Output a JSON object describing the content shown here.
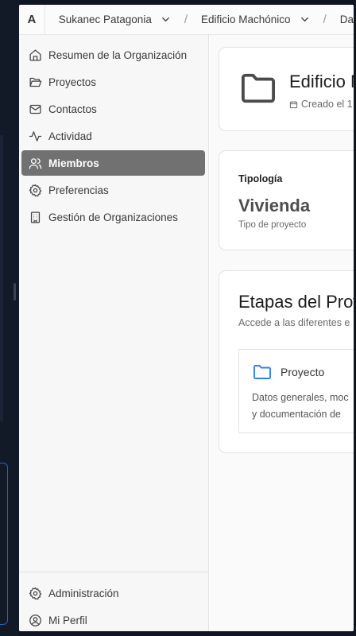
{
  "app": {
    "logo_letter": "A"
  },
  "breadcrumb": [
    {
      "label": "Sukanec Patagonia"
    },
    {
      "label": "Edificio Machónico"
    },
    {
      "label": "Da"
    }
  ],
  "breadcrumb_separator": "/",
  "sidebar": {
    "items": [
      {
        "label": "Resumen de la Organización",
        "icon": "home-icon",
        "active": false
      },
      {
        "label": "Proyectos",
        "icon": "folder-open-icon",
        "active": false
      },
      {
        "label": "Contactos",
        "icon": "mail-icon",
        "active": false
      },
      {
        "label": "Actividad",
        "icon": "activity-icon",
        "active": false
      },
      {
        "label": "Miembros",
        "icon": "users-icon",
        "active": true
      },
      {
        "label": "Preferencias",
        "icon": "gear-icon",
        "active": false
      },
      {
        "label": "Gestión de Organizaciones",
        "icon": "building-icon",
        "active": false
      }
    ],
    "bottom_items": [
      {
        "label": "Administración",
        "icon": "gear-icon"
      },
      {
        "label": "Mi Perfil",
        "icon": "user-circle-icon"
      }
    ]
  },
  "header_card": {
    "title": "Edificio M",
    "created": "Creado el 1"
  },
  "tipologia_card": {
    "label": "Tipología",
    "value": "Vivienda",
    "sub": "Tipo de proyecto"
  },
  "etapas_card": {
    "title": "Etapas del Proy",
    "description": "Accede a las diferentes e",
    "stage": {
      "name": "Proyecto",
      "desc_line1": "Datos generales, moc",
      "desc_line2": "y documentación de"
    }
  },
  "colors": {
    "active_nav_bg": "#717171",
    "stage_icon": "#2f80ed",
    "desktop_bg": "#0f1623"
  }
}
